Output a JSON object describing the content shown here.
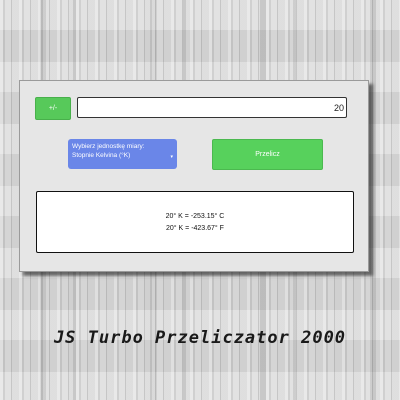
{
  "converter": {
    "sign_toggle_label": "+/-",
    "input_value": "20",
    "unit_select": {
      "label": "Wybierz jednostkę miary:",
      "selected": "Stopnie Kelvina (°K)",
      "arrow": "▾"
    },
    "convert_label": "Przelicz",
    "results": [
      "20° K = -253.15° C",
      "20° K = -423.67° F"
    ]
  },
  "footer": {
    "title": "JS Turbo Przeliczator 2000"
  },
  "colors": {
    "button_green": "#57d15c",
    "select_blue": "#6a86e8",
    "panel_gray": "#e6e6e6"
  }
}
